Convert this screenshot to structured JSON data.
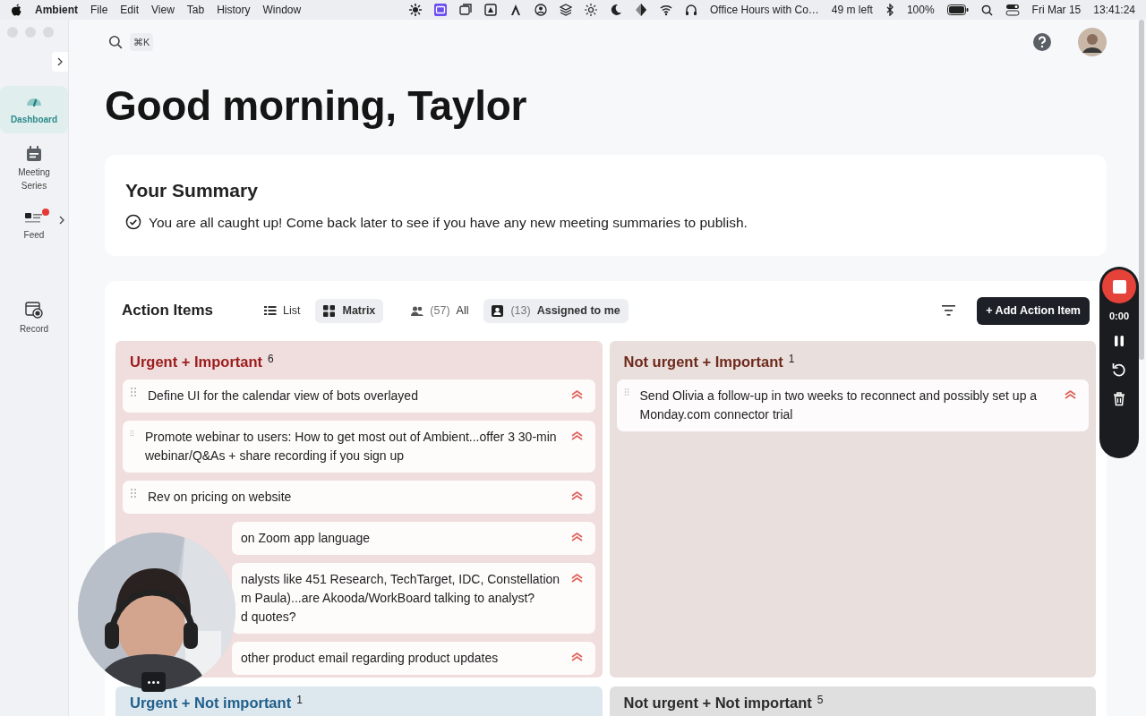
{
  "menu_bar": {
    "app": "Ambient",
    "menus": [
      "File",
      "Edit",
      "View",
      "Tab",
      "History",
      "Window"
    ],
    "event": "Office Hours with Co…",
    "event_time": "49 m left",
    "battery": "100%",
    "date": "Fri Mar 15",
    "time": "13:41:24"
  },
  "sidebar": {
    "items": [
      {
        "label": "Dashboard",
        "kind": "dashboard",
        "selected": true,
        "notification": false,
        "expandable": false
      },
      {
        "label": "Meeting Series",
        "kind": "calendar",
        "selected": false,
        "notification": false,
        "expandable": false
      },
      {
        "label": "Feed",
        "kind": "feed",
        "selected": false,
        "notification": true,
        "expandable": true
      },
      {
        "label": "Record",
        "kind": "record",
        "selected": false,
        "notification": false,
        "expandable": false
      }
    ]
  },
  "search": {
    "shortcut": "⌘K"
  },
  "greeting": "Good morning, Taylor",
  "summary": {
    "title": "Your Summary",
    "message": "You are all caught up! Come back later to see if you have any new meeting summaries to publish."
  },
  "action_items": {
    "title": "Action Items",
    "views": [
      {
        "label": "List",
        "kind": "list",
        "selected": false
      },
      {
        "label": "Matrix",
        "kind": "matrix",
        "selected": true
      }
    ],
    "filters": [
      {
        "count": "(57)",
        "label": "All",
        "kind": "people",
        "selected": false
      },
      {
        "count": "(13)",
        "label": "Assigned to me",
        "kind": "person",
        "selected": true
      }
    ],
    "add_button": "+ Add Action Item",
    "quadrants": [
      {
        "title": "Urgent + Important",
        "count": "6",
        "color": "#9b1c1c",
        "items": [
          {
            "text": "Define UI for the calendar view of bots overlayed",
            "kind": "full"
          },
          {
            "text": "Promote webinar to users: How to get most out of Ambient...offer 3 30-min webinar/Q&As + share recording if you sign up",
            "kind": "full"
          },
          {
            "text": "Rev on pricing on website",
            "kind": "full"
          },
          {
            "text": "on Zoom app language",
            "kind": "partly-hidden"
          },
          {
            "text_lines": [
              "nalysts like 451 Research, TechTarget, IDC, Constellation",
              "m Paula)...are Akooda/WorkBoard talking to analyst?",
              "d quotes?"
            ],
            "kind": "partly-hidden"
          },
          {
            "text": "other product email regarding product updates",
            "kind": "partly-hidden"
          }
        ]
      },
      {
        "title": "Not urgent + Important",
        "count": "1",
        "color": "#6e2a1c",
        "items": [
          {
            "text": "Send Olivia a follow-up in two weeks to reconnect and possibly set up a Monday.com connector trial",
            "kind": "full"
          }
        ]
      },
      {
        "title": "Urgent + Not important",
        "count": "1",
        "color": "#1f5f8b"
      },
      {
        "title": "Not urgent + Not important",
        "count": "5",
        "color": "#2b2b2b"
      }
    ]
  },
  "recorder": {
    "timer": "0:00"
  }
}
